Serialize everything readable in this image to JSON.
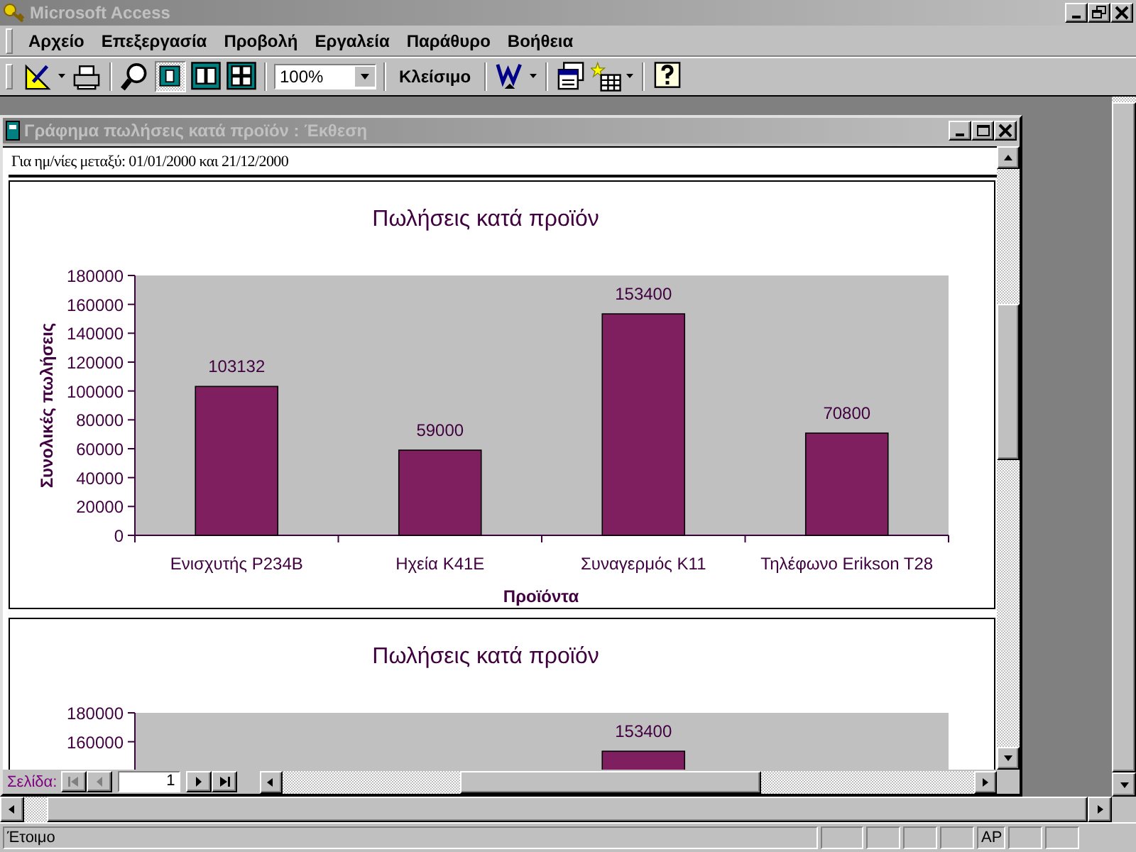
{
  "window": {
    "title": "Microsoft Access"
  },
  "menu": [
    "Αρχείο",
    "Επεξεργασία",
    "Προβολή",
    "Εργαλεία",
    "Παράθυρο",
    "Βοήθεια"
  ],
  "toolbar": {
    "zoom": "100%",
    "close_button": "Κλείσιμο"
  },
  "report_window": {
    "title": "Γράφημα πωλήσεις κατά προϊόν : Έκθεση",
    "date_line": "Για ημ/νίες μεταξύ: 01/01/2000 και 21/12/2000",
    "sections": [
      {
        "chart_data": {
          "type": "bar",
          "title": "Πωλήσεις κατά προϊόν",
          "xlabel": "Προϊόντα",
          "ylabel": "Συνολικές πωλήσεις",
          "categories": [
            "Ενισχυτής P234B",
            "Ηχεία K41E",
            "Συναγερμός K11",
            "Τηλέφωνο Erikson T28"
          ],
          "values": [
            103132,
            59000,
            153400,
            70800
          ],
          "ylim": [
            0,
            180000
          ],
          "yticks": [
            0,
            20000,
            40000,
            60000,
            80000,
            100000,
            120000,
            140000,
            160000,
            180000
          ],
          "data_labels": true
        }
      },
      {
        "chart_data": {
          "type": "bar",
          "title": "Πωλήσεις κατά προϊόν",
          "values": [
            null,
            null,
            153400,
            null
          ],
          "ylim": [
            0,
            180000
          ],
          "yticks": [
            160000,
            180000
          ],
          "data_labels": true
        }
      }
    ],
    "navigation": {
      "label": "Σελίδα:",
      "page": "1",
      "buttons": [
        {
          "kind": "first",
          "disabled": true
        },
        {
          "kind": "previous",
          "disabled": true
        },
        {
          "kind": "next",
          "disabled": false
        },
        {
          "kind": "last",
          "disabled": false
        }
      ]
    }
  },
  "status_bar": {
    "text": "Έτοιμο",
    "indicators": [
      "AP"
    ]
  }
}
